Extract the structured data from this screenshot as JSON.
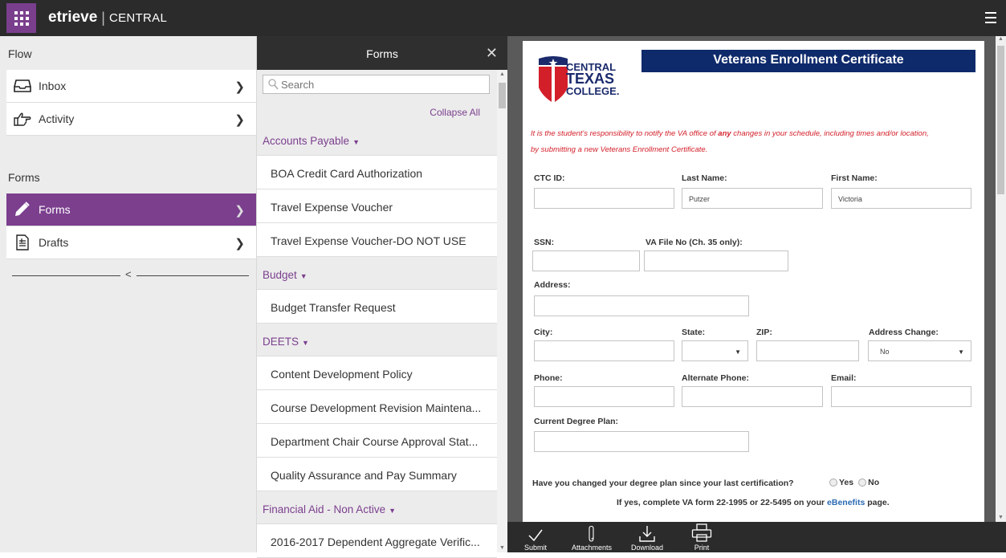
{
  "header": {
    "logo": "etrieve",
    "separator": "|",
    "product": "CENTRAL"
  },
  "leftnav": {
    "flow_section": "Flow",
    "flow_items": [
      {
        "label": "Inbox",
        "icon": "inbox-icon"
      },
      {
        "label": "Activity",
        "icon": "hand-pointing-icon"
      }
    ],
    "forms_section": "Forms",
    "forms_items": [
      {
        "label": "Forms",
        "icon": "pencil-icon",
        "active": true
      },
      {
        "label": "Drafts",
        "icon": "document-icon"
      }
    ]
  },
  "forms_panel": {
    "title": "Forms",
    "search_placeholder": "Search",
    "collapse_all": "Collapse All",
    "categories": [
      {
        "name": "Accounts Payable",
        "forms": [
          "BOA Credit Card Authorization",
          "Travel Expense Voucher",
          "Travel Expense Voucher-DO NOT USE"
        ]
      },
      {
        "name": "Budget",
        "forms": [
          "Budget Transfer Request"
        ]
      },
      {
        "name": "DEETS",
        "forms": [
          "Content Development Policy",
          "Course Development Revision Maintena...",
          "Department Chair Course Approval Stat...",
          "Quality Assurance and Pay Summary"
        ]
      },
      {
        "name": "Financial Aid - Non Active",
        "forms": [
          "2016-2017 Dependent Aggregate Verific..."
        ]
      }
    ]
  },
  "document": {
    "logo_lines": [
      "CENTRAL",
      "TEXAS",
      "COLLEGE."
    ],
    "title": "Veterans Enrollment Certificate",
    "notice_part1": "It is the student's responsibility to notify the VA office of ",
    "notice_bold": "any",
    "notice_part2": " changes in your schedule, including times and/or location,",
    "notice_line2": "by submitting a new Veterans Enrollment Certificate.",
    "labels": {
      "ctc_id": "CTC ID:",
      "last_name": "Last Name:",
      "first_name": "First Name:",
      "ssn": "SSN:",
      "va_file": "VA File No (Ch. 35 only):",
      "address": "Address:",
      "city": "City:",
      "state": "State:",
      "zip": "ZIP:",
      "address_change": "Address Change:",
      "phone": "Phone:",
      "alt_phone": "Alternate Phone:",
      "email": "Email:",
      "degree_plan": "Current Degree Plan:"
    },
    "values": {
      "ctc_id": "",
      "last_name": "Putzer",
      "first_name": "Victoria",
      "ssn": "",
      "va_file": "",
      "address": "",
      "city": "",
      "state": "",
      "zip": "",
      "address_change": "No",
      "phone": "",
      "alt_phone": "",
      "email": "",
      "degree_plan": ""
    },
    "question": "Have you changed your degree plan since your last certification?",
    "radio_yes": "Yes",
    "radio_no": "No",
    "followup_prefix": "If yes, complete VA form 22-1995 or 22-5495 on your ",
    "followup_link": "eBenefits",
    "followup_suffix": " page."
  },
  "toolbar": {
    "submit": "Submit",
    "attachments": "Attachments",
    "download": "Download",
    "print": "Print"
  },
  "colors": {
    "accent": "#7b3f8e",
    "topbar": "#2b2b2b",
    "doc_title_bg": "#0f2a6b",
    "notice": "#d21f2a"
  }
}
